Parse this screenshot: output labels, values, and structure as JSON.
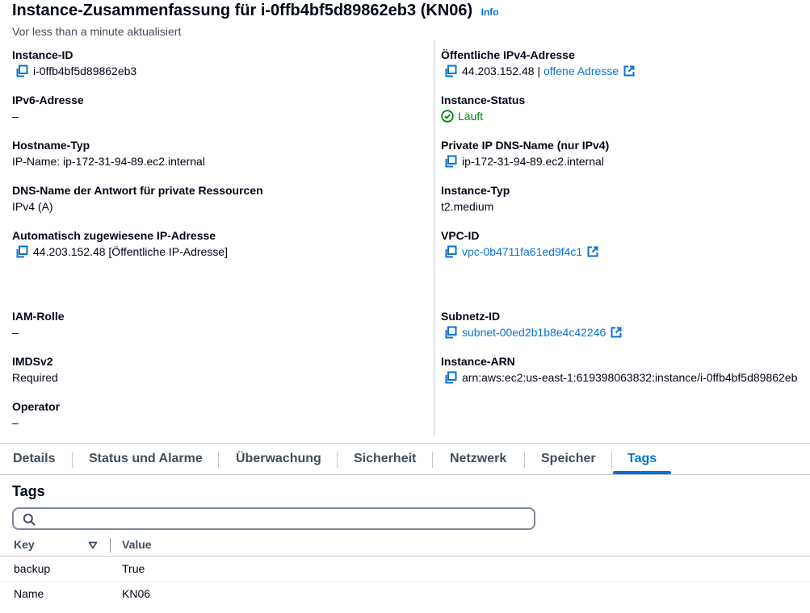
{
  "header": {
    "title": "Instance-Zusammenfassung für i-0ffb4bf5d89862eb3 (KN06)",
    "info_label": "Info",
    "subtitle": "Vor less than a minute aktualisiert"
  },
  "left_fields": {
    "instance_id": {
      "label": "Instance-ID",
      "value": "i-0ffb4bf5d89862eb3"
    },
    "ipv6": {
      "label": "IPv6-Adresse",
      "value": "–"
    },
    "hostname_type": {
      "label": "Hostname-Typ",
      "value": "IP-Name: ip-172-31-94-89.ec2.internal"
    },
    "dns_private": {
      "label": "DNS-Name der Antwort für private Ressourcen",
      "value": "IPv4 (A)"
    },
    "auto_ip": {
      "label": "Automatisch zugewiesene IP-Adresse",
      "value": "44.203.152.48 [Öffentliche IP-Adresse]"
    },
    "iam_role": {
      "label": "IAM-Rolle",
      "value": "–"
    },
    "imdsv2": {
      "label": "IMDSv2",
      "value": "Required"
    },
    "operator": {
      "label": "Operator",
      "value": "–"
    }
  },
  "right_fields": {
    "public_ipv4": {
      "label": "Öffentliche IPv4-Adresse",
      "value": "44.203.152.48",
      "separator": " | ",
      "link": "offene Adresse"
    },
    "instance_status": {
      "label": "Instance-Status",
      "value": "Läuft"
    },
    "private_dns": {
      "label": "Private IP DNS-Name (nur IPv4)",
      "value": "ip-172-31-94-89.ec2.internal"
    },
    "instance_type": {
      "label": "Instance-Typ",
      "value": "t2.medium"
    },
    "vpc_id": {
      "label": "VPC-ID",
      "value": "vpc-0b4711fa61ed9f4c1"
    },
    "subnet_id": {
      "label": "Subnetz-ID",
      "value": "subnet-00ed2b1b8e4c42246"
    },
    "instance_arn": {
      "label": "Instance-ARN",
      "value": "arn:aws:ec2:us-east-1:619398063832:instance/i-0ffb4bf5d89862eb"
    }
  },
  "tabs": [
    {
      "label": "Details"
    },
    {
      "label": "Status und Alarme"
    },
    {
      "label": "Überwachung"
    },
    {
      "label": "Sicherheit"
    },
    {
      "label": "Netzwerk"
    },
    {
      "label": "Speicher"
    },
    {
      "label": "Tags",
      "active": true
    }
  ],
  "tags_section": {
    "title": "Tags",
    "search_placeholder": "",
    "columns": [
      "Key",
      "Value"
    ],
    "rows": [
      {
        "key": "backup",
        "value": "True"
      },
      {
        "key": "Name",
        "value": "KN06"
      }
    ]
  },
  "colors": {
    "link": "#0972d3",
    "success": "#037f0c",
    "text": "#000716",
    "muted": "#414d5c",
    "border": "#c6c6cd"
  },
  "icons": [
    "copy-icon",
    "external-link-icon",
    "status-ok-icon",
    "search-icon",
    "sort-icon"
  ]
}
